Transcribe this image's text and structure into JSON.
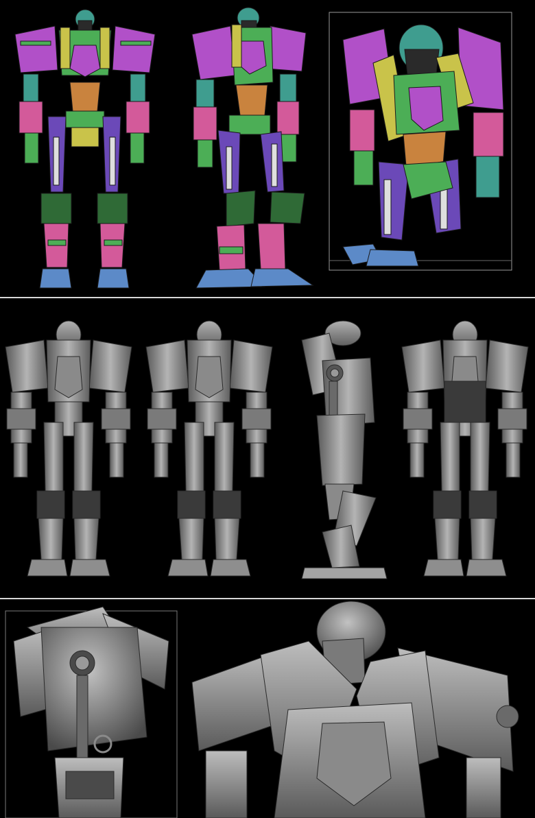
{
  "sheet": {
    "background": "#000000",
    "separator_color": "#d8d8d8"
  },
  "panels": [
    {
      "name": "polygroup-views",
      "views": [
        "front",
        "three-quarter",
        "close-up"
      ]
    },
    {
      "name": "clay-turnaround",
      "views": [
        "front-left",
        "front",
        "side",
        "back"
      ]
    },
    {
      "name": "clay-details",
      "views": [
        "back-detail",
        "chest-detail"
      ]
    }
  ],
  "palette": {
    "magenta": "#b150c8",
    "green": "#4cae56",
    "yellow": "#c9c34a",
    "orange": "#c9833e",
    "blue": "#5c8ac8",
    "violet": "#6b49b8",
    "pink": "#d35a9a",
    "teal": "#3f9d8f",
    "clay_light": "#a8a8a8",
    "clay_mid": "#7c7c7c",
    "clay_dark": "#3e3e3e"
  }
}
